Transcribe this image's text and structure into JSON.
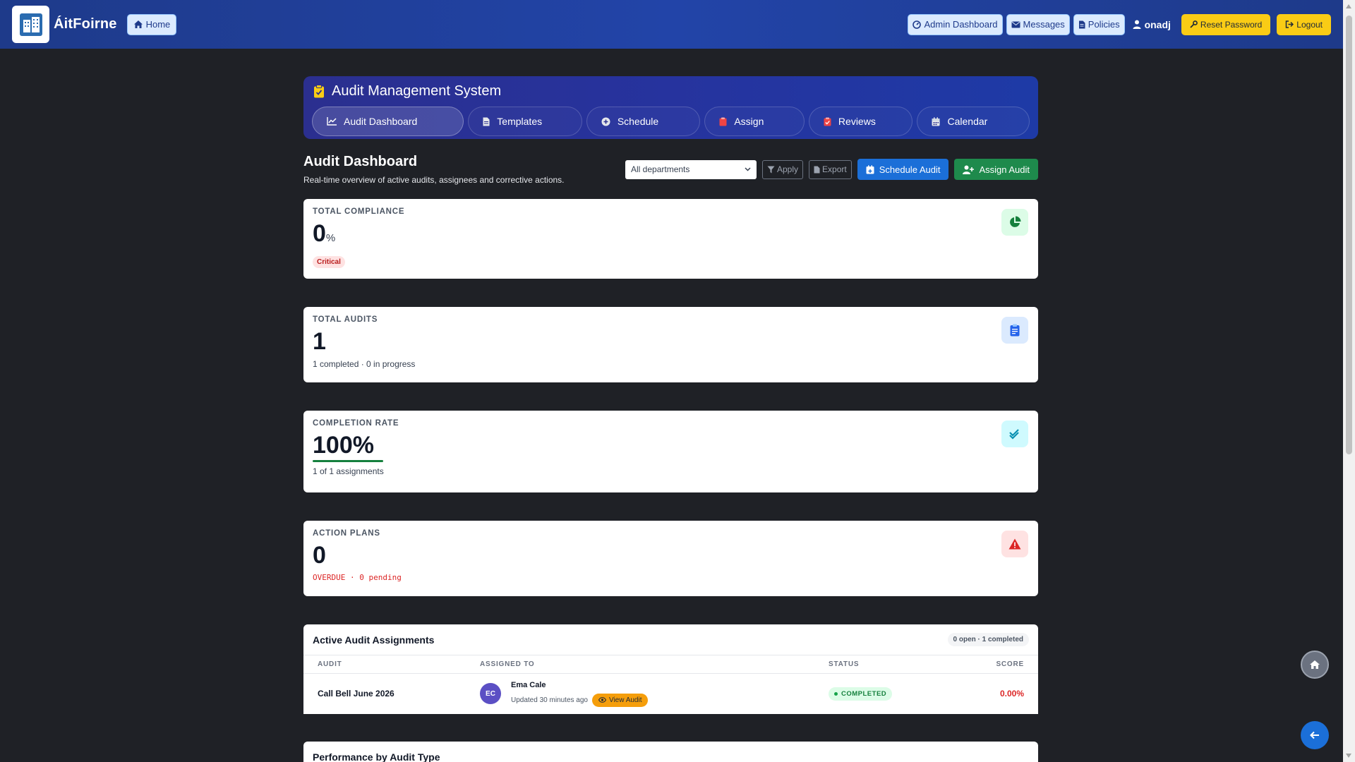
{
  "navbar": {
    "brand": "ÁitFoirne",
    "home_label": "Home",
    "admin_dashboard_label": "Admin Dashboard",
    "messages_label": "Messages",
    "policies_label": "Policies",
    "username": "onadj",
    "reset_password_label": "Reset Password",
    "logout_label": "Logout"
  },
  "system": {
    "title": "Audit Management System",
    "tabs": [
      {
        "label": "Audit Dashboard",
        "icon": "chart-line-icon",
        "active": true
      },
      {
        "label": "Templates",
        "icon": "file-icon"
      },
      {
        "label": "Schedule",
        "icon": "plus-circle-icon"
      },
      {
        "label": "Assign",
        "icon": "clipboard-icon"
      },
      {
        "label": "Reviews",
        "icon": "clipboard-check-icon"
      },
      {
        "label": "Calendar",
        "icon": "calendar-icon"
      }
    ]
  },
  "dashboard": {
    "title": "Audit Dashboard",
    "subtitle": "Real-time overview of active audits, assignees and corrective actions.",
    "department_filter": "All departments",
    "apply_label": "Apply",
    "export_label": "Export",
    "schedule_audit_label": "Schedule Audit",
    "assign_audit_label": "Assign Audit"
  },
  "metrics": {
    "compliance": {
      "label": "TOTAL COMPLIANCE",
      "value": "0",
      "unit": "%",
      "badge": "Critical",
      "icon": "pie-chart-icon",
      "icon_color": "#15803d",
      "icon_bg": "#dcfce7"
    },
    "audits": {
      "label": "TOTAL AUDITS",
      "value": "1",
      "note": "1 completed · 0 in progress",
      "icon": "clipboard-list-icon",
      "icon_color": "#2563eb",
      "icon_bg": "#dbeafe"
    },
    "completion": {
      "label": "COMPLETION RATE",
      "value": "100%",
      "note": "1 of 1 assignments",
      "progress": 1.0,
      "icon": "double-check-icon",
      "icon_color": "#0891b2",
      "icon_bg": "#cffafe"
    },
    "action_plans": {
      "label": "ACTION PLANS",
      "value": "0",
      "note": "OVERDUE · 0 pending",
      "icon": "warning-icon",
      "icon_color": "#dc2626",
      "icon_bg": "#fee2e2"
    }
  },
  "assignments": {
    "title": "Active Audit Assignments",
    "count": "0 open · 1 completed",
    "columns": [
      "AUDIT",
      "ASSIGNED TO",
      "STATUS",
      "SCORE"
    ],
    "rows": [
      {
        "audit": "Call Bell June 2026",
        "initials": "EC",
        "assignee": "Ema Cale",
        "updated": "Updated 30 minutes ago",
        "view_label": "View Audit",
        "status": "COMPLETED",
        "score": "0.00%"
      }
    ]
  },
  "performance": {
    "title": "Performance by Audit Type"
  }
}
